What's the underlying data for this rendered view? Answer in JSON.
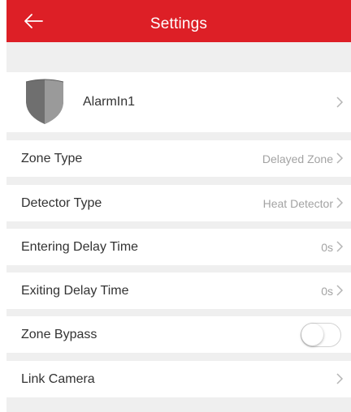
{
  "header": {
    "title": "Settings",
    "back_icon": "arrow-left-icon",
    "background_color": "#dd1f26"
  },
  "device": {
    "name": "AlarmIn1",
    "icon": "shield-icon"
  },
  "rows": [
    {
      "label": "Zone Type",
      "value": "Delayed Zone"
    },
    {
      "label": "Detector Type",
      "value": "Heat Detector"
    },
    {
      "label": "Entering Delay Time",
      "value": "0s"
    },
    {
      "label": "Exiting Delay Time",
      "value": "0s"
    },
    {
      "label": "Zone Bypass",
      "value": "",
      "toggle": false
    },
    {
      "label": "Link Camera",
      "value": ""
    }
  ],
  "colors": {
    "accent": "#dd1f26",
    "background": "#efefef",
    "secondary_text": "#a3a3a3"
  }
}
